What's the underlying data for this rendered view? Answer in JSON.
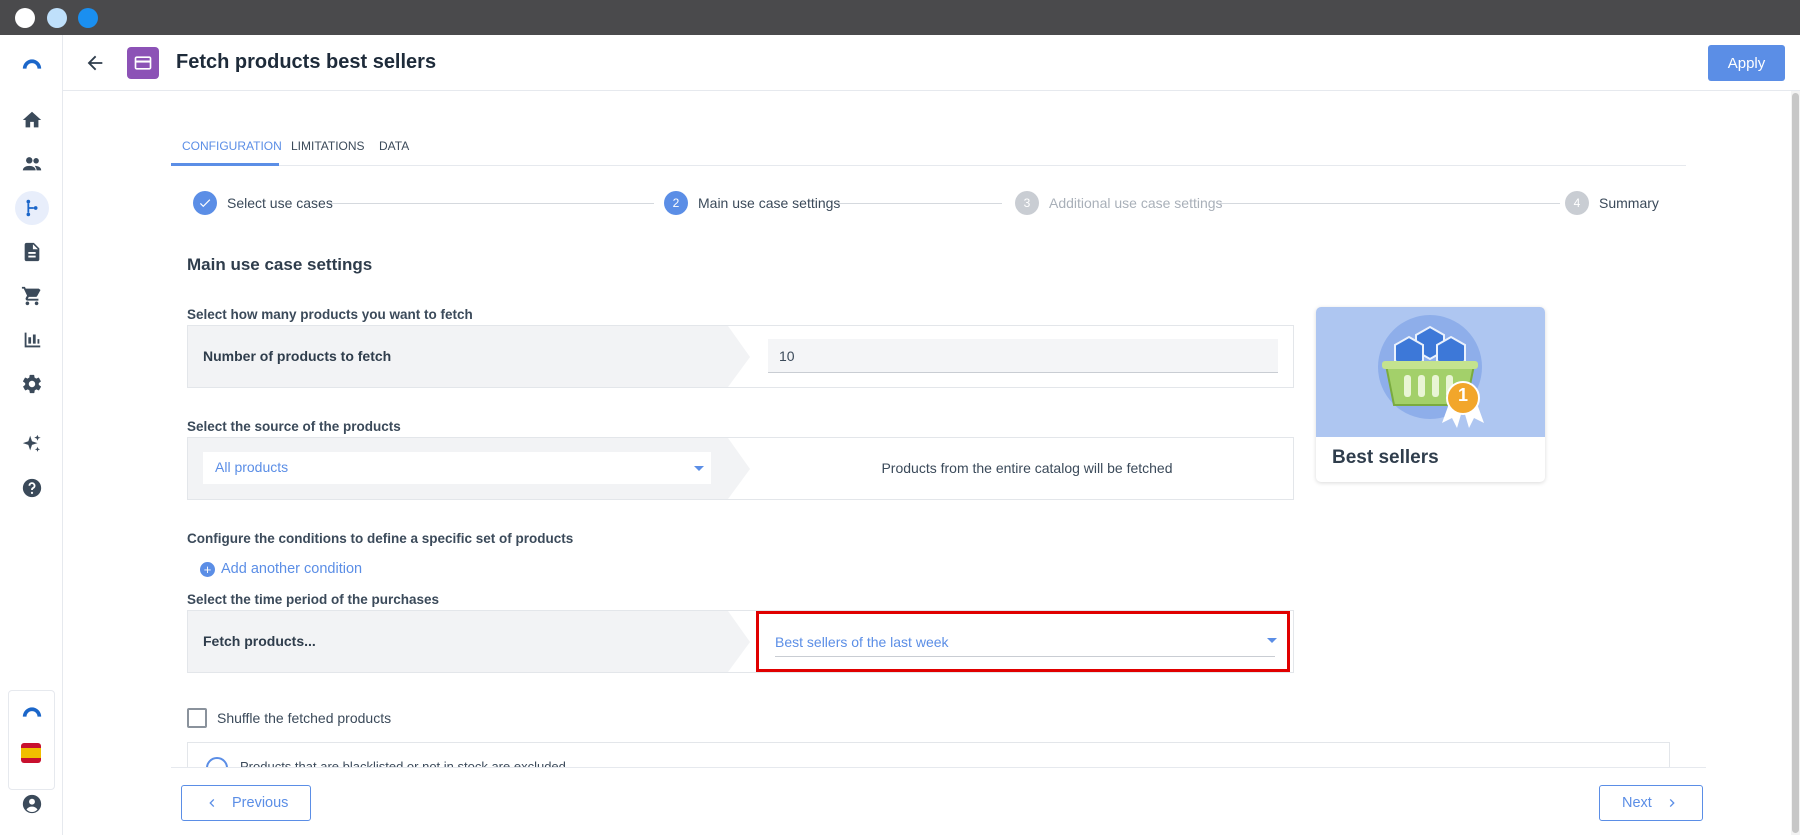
{
  "header": {
    "title": "Fetch products best sellers",
    "apply_label": "Apply"
  },
  "tabs": [
    {
      "label": "CONFIGURATION",
      "active": true
    },
    {
      "label": "LIMITATIONS",
      "active": false
    },
    {
      "label": "DATA",
      "active": false
    }
  ],
  "stepper": {
    "steps": [
      {
        "number": "",
        "label": "Select use cases",
        "state": "done"
      },
      {
        "number": "2",
        "label": "Main use case settings",
        "state": "current"
      },
      {
        "number": "3",
        "label": "Additional use case settings",
        "state": "todo"
      },
      {
        "number": "4",
        "label": "Summary",
        "state": "todo"
      }
    ]
  },
  "main": {
    "section_title": "Main use case settings",
    "products_count": {
      "question": "Select how many products you want to fetch",
      "label": "Number of products to fetch",
      "value": "10"
    },
    "source": {
      "question": "Select the source of the products",
      "selected": "All products",
      "description": "Products from the entire catalog will be fetched"
    },
    "conditions": {
      "question": "Configure the conditions to define a specific set of products",
      "add_label": "Add another condition"
    },
    "period": {
      "question": "Select the time period of the purchases",
      "label": "Fetch products...",
      "selected": "Best sellers of the last week"
    },
    "shuffle_label": "Shuffle the fetched products",
    "info_text": "Products that are blacklisted or not in stock are excluded"
  },
  "card": {
    "title": "Best sellers",
    "badge_number": "1"
  },
  "footer": {
    "previous_label": "Previous",
    "next_label": "Next"
  },
  "sidebar": {
    "items": [
      "home-icon",
      "people-icon",
      "flow-icon",
      "document-icon",
      "cart-icon",
      "bar-chart-icon",
      "gear-icon",
      "sparkle-icon",
      "help-icon"
    ],
    "active": "flow-icon"
  },
  "colors": {
    "accent": "#5b8ee6",
    "highlight": "#e00000",
    "app_icon": "#8c52b6"
  }
}
